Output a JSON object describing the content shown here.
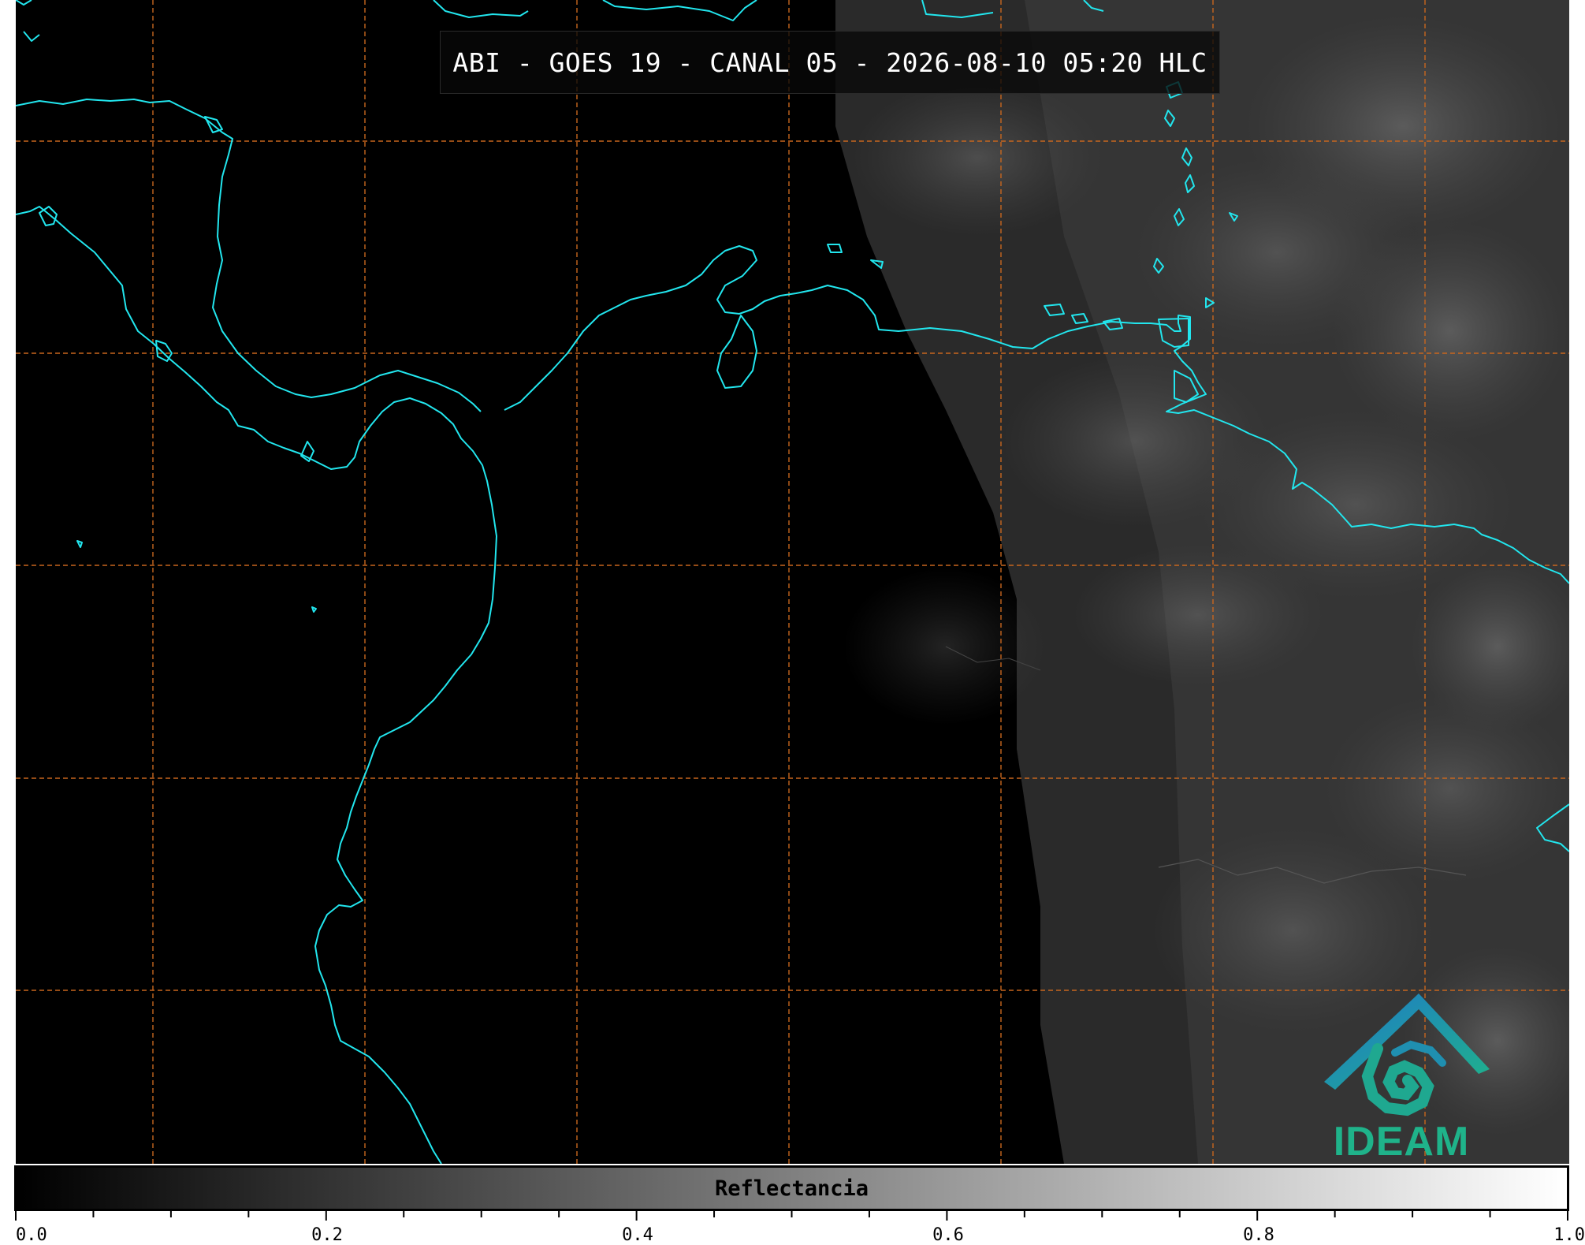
{
  "title": "ABI - GOES 19 - CANAL 05 - 2026-08-10 05:20 HLC",
  "colorbar": {
    "label": "Reflectancia",
    "min": 0.0,
    "max": 1.0,
    "ticks": [
      "0.0",
      "0.2",
      "0.4",
      "0.6",
      "0.8",
      "1.0"
    ],
    "colors": [
      "#000000",
      "#ffffff"
    ]
  },
  "logo": {
    "text": "IDEAM"
  },
  "colors": {
    "background": "#000000",
    "coastline": "#22e6ee",
    "gridline": "#c8661e",
    "logo_blue": "#1f79c8",
    "logo_green": "#1fb38a"
  },
  "grid": {
    "style": "dashed",
    "visible": true
  }
}
